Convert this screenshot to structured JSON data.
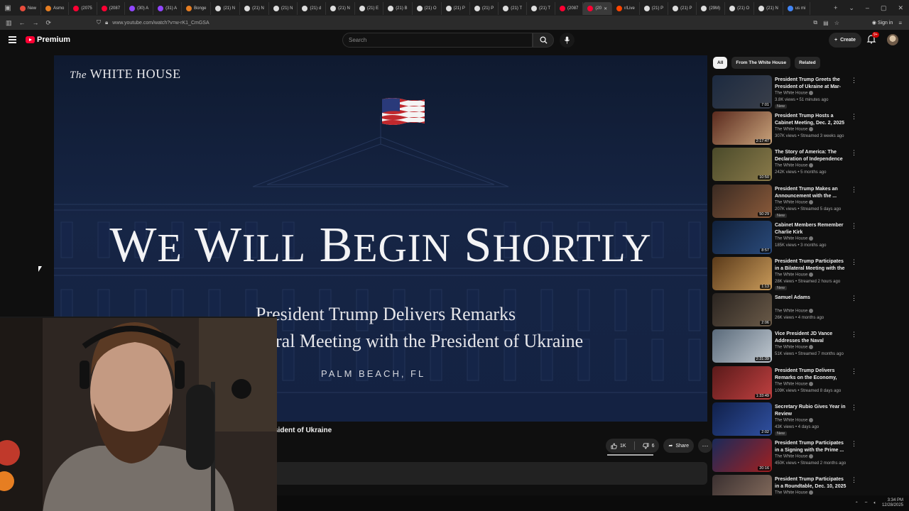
{
  "browser": {
    "tabs": [
      {
        "label": "New",
        "color": "#e74c3c"
      },
      {
        "label": "Asmo",
        "color": "#e67e22"
      },
      {
        "label": "(2075",
        "color": "#ff0033"
      },
      {
        "label": "(2087",
        "color": "#ff0033"
      },
      {
        "label": "(30) A",
        "color": "#9146ff"
      },
      {
        "label": "(31) A",
        "color": "#9146ff"
      },
      {
        "label": "Bonge",
        "color": "#e67e22"
      },
      {
        "label": "(21) N",
        "color": "#dddddd"
      },
      {
        "label": "(21) N",
        "color": "#dddddd"
      },
      {
        "label": "(21) N",
        "color": "#dddddd"
      },
      {
        "label": "(21) d",
        "color": "#dddddd"
      },
      {
        "label": "(21) N",
        "color": "#dddddd"
      },
      {
        "label": "(21) E",
        "color": "#dddddd"
      },
      {
        "label": "(21) B",
        "color": "#dddddd"
      },
      {
        "label": "(21) O",
        "color": "#dddddd"
      },
      {
        "label": "(21) P",
        "color": "#dddddd"
      },
      {
        "label": "(21) P",
        "color": "#dddddd"
      },
      {
        "label": "(21) T",
        "color": "#dddddd"
      },
      {
        "label": "(21) T",
        "color": "#dddddd"
      },
      {
        "label": "(2087",
        "color": "#ff0033"
      },
      {
        "label": "(20",
        "color": "#ff0033",
        "active": true
      },
      {
        "label": "r/Live",
        "color": "#ff4500"
      },
      {
        "label": "(21) P",
        "color": "#dddddd"
      },
      {
        "label": "(21) P",
        "color": "#dddddd"
      },
      {
        "label": "(29M)",
        "color": "#dddddd"
      },
      {
        "label": "(21) O",
        "color": "#dddddd"
      },
      {
        "label": "(21) N",
        "color": "#dddddd"
      },
      {
        "label": "us mi",
        "color": "#4285f4"
      }
    ],
    "url": "www.youtube.com/watch?v=w-rK1_CmGSA",
    "sign_in": "Sign in"
  },
  "masthead": {
    "brand": "Premium",
    "search_placeholder": "Search",
    "create_label": "Create",
    "notif_count": "9+"
  },
  "player": {
    "logo_prefix": "The",
    "logo_main": "WHITE HOUSE",
    "headline_words": [
      {
        "cap": "W",
        "rest": "E"
      },
      {
        "cap": "W",
        "rest": "ILL"
      },
      {
        "cap": "B",
        "rest": "EGIN"
      },
      {
        "cap": "S",
        "rest": "HORTLY"
      }
    ],
    "subtitle_line1": "President Trump Delivers Remarks",
    "subtitle_line2": "ral Meeting with the President of Ukraine",
    "location": "PALM BEACH, FL"
  },
  "video": {
    "title_visible": "sident of Ukraine",
    "likes": "1K",
    "dislikes": "6",
    "share": "Share",
    "like_ratio": 0.99
  },
  "sidebar": {
    "chips": [
      {
        "label": "All",
        "active": true
      },
      {
        "label": "From The White House",
        "active": false
      },
      {
        "label": "Related",
        "active": false
      }
    ],
    "items": [
      {
        "title": "President Trump Greets the President of Ukraine at Mar-a-...",
        "channel": "The White House",
        "meta": "3.8K views • 51 minutes ago",
        "duration": "7:01",
        "badge": "New",
        "thumb": [
          "#1c2a40",
          "#3a3f4a"
        ]
      },
      {
        "title": "President Trump Hosts a Cabinet Meeting, Dec. 2, 2025",
        "channel": "The White House",
        "meta": "307K views • Streamed 3 weeks ago",
        "duration": "2:17:47",
        "badge": "",
        "thumb": [
          "#5a2a1e",
          "#c8a27a"
        ]
      },
      {
        "title": "The Story of America: The Declaration of Independence",
        "channel": "The White House",
        "meta": "242K views • 5 months ago",
        "duration": "10:50",
        "badge": "",
        "thumb": [
          "#4a4a2a",
          "#8a7a4a"
        ]
      },
      {
        "title": "President Trump Makes an Announcement with the ...",
        "channel": "The White House",
        "meta": "207K views • Streamed 5 days ago",
        "duration": "50:29",
        "badge": "New",
        "thumb": [
          "#3a2a22",
          "#8a5a3a"
        ]
      },
      {
        "title": "Cabinet Members Remember Charlie Kirk",
        "channel": "The White House",
        "meta": "185K views • 3 months ago",
        "duration": "8:57",
        "badge": "",
        "thumb": [
          "#10203a",
          "#2a4a7a"
        ]
      },
      {
        "title": "President Trump Participates in a Bilateral Meeting with the ...",
        "channel": "The White House",
        "meta": "28K views • Streamed 2 hours ago",
        "duration": "1:13",
        "badge": "New",
        "thumb": [
          "#5a3a1a",
          "#c89a5a"
        ]
      },
      {
        "title": "Samuel Adams",
        "channel": "The White House",
        "meta": "26K views • 4 months ago",
        "duration": "2:06",
        "badge": "",
        "thumb": [
          "#2a2420",
          "#6a5a48"
        ]
      },
      {
        "title": "Vice President JD Vance Addresses the Naval Academy...",
        "channel": "The White House",
        "meta": "51K views • Streamed 7 months ago",
        "duration": "2:31:39",
        "badge": "",
        "thumb": [
          "#5a6a7a",
          "#c0c8d0"
        ]
      },
      {
        "title": "President Trump Delivers Remarks on the Economy, Dec...",
        "channel": "The White House",
        "meta": "109K views • Streamed 8 days ago",
        "duration": "1:33:49",
        "badge": "",
        "thumb": [
          "#5a1a1a",
          "#c04040"
        ]
      },
      {
        "title": "Secretary Rubio Gives Year in Review",
        "channel": "The White House",
        "meta": "43K views • 4 days ago",
        "duration": "2:02",
        "badge": "New",
        "thumb": [
          "#10204a",
          "#3050a0"
        ]
      },
      {
        "title": "President Trump Participates in a Signing with the Prime ...",
        "channel": "The White House",
        "meta": "450K views • Streamed 2 months ago",
        "duration": "20:16",
        "badge": "",
        "thumb": [
          "#1a2a5a",
          "#a02020"
        ]
      },
      {
        "title": "President Trump Participates in a Roundtable, Dec. 10, 2025",
        "channel": "The White House",
        "meta": "",
        "duration": "",
        "badge": "",
        "thumb": [
          "#3a3030",
          "#8a7060"
        ]
      }
    ]
  },
  "taskbar": {
    "time": "3:34 PM",
    "date": "12/28/2025"
  }
}
